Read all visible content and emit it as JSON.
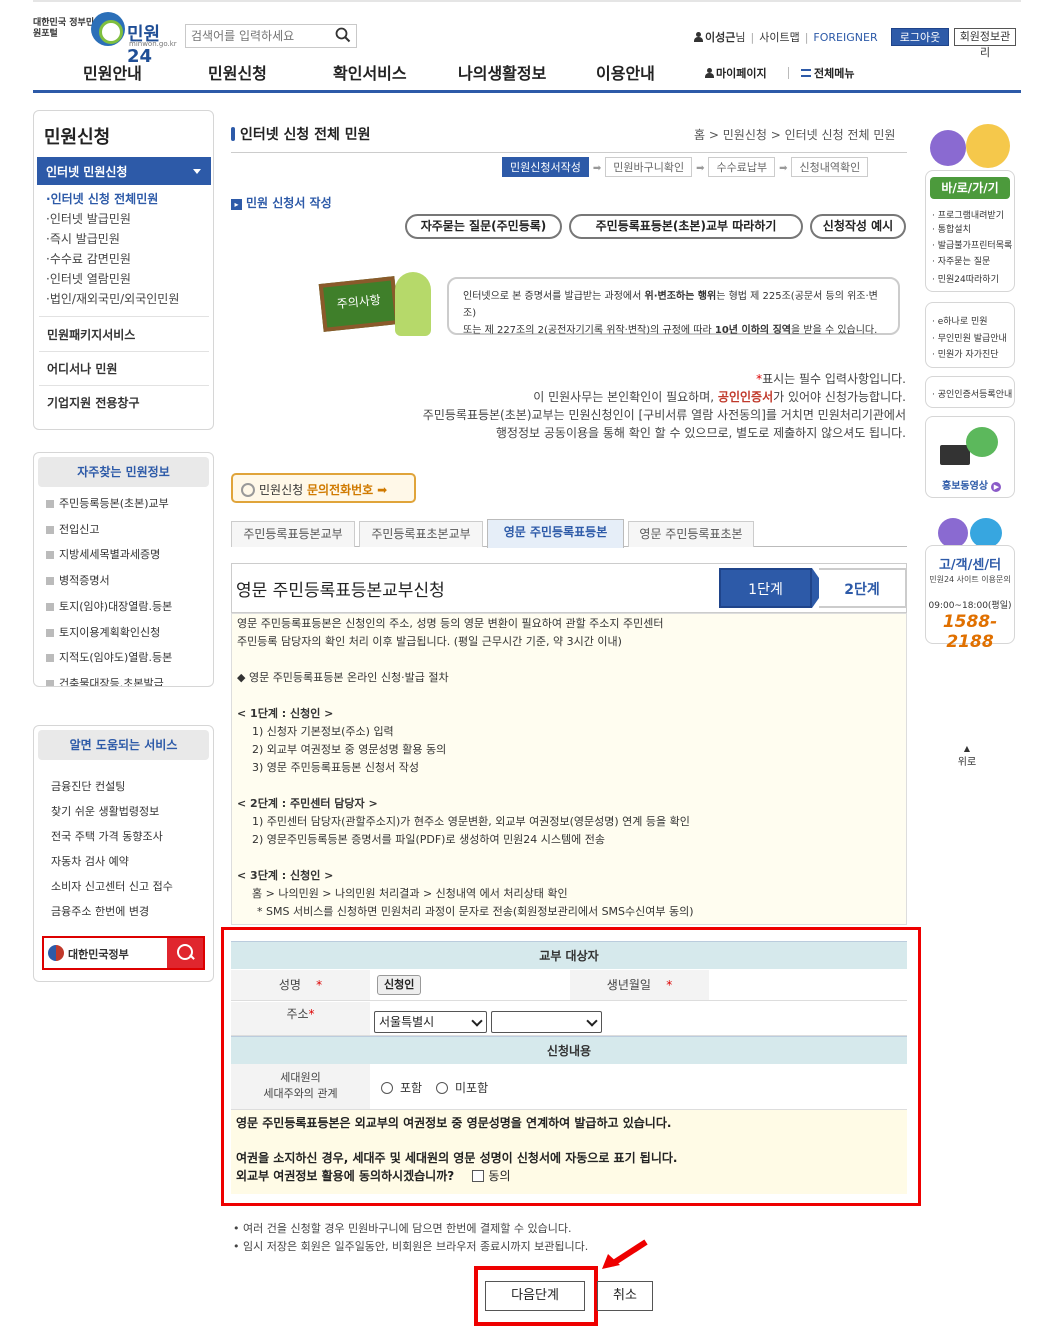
{
  "header": {
    "gov_label": "대한민국 정부민원포털",
    "logo_text": "민원24",
    "logo_url": "minwon.go.kr",
    "search_placeholder": "검색어를 입력하세요",
    "user_name": "이성근",
    "user_suffix": "님",
    "sitemap": "사이트맵",
    "foreigner": "FOREIGNER",
    "logout": "로그아웃",
    "member_info": "회원정보관리"
  },
  "gnb": {
    "items": [
      "민원안내",
      "민원신청",
      "확인서비스",
      "나의생활정보",
      "이용안내"
    ],
    "mypage": "마이페이지",
    "allmenu": "전체메뉴"
  },
  "lnb": {
    "title": "민원신청",
    "active": "인터넷 민원신청",
    "subs": [
      "인터넷 신청 전체민원",
      "인터넷 발급민원",
      "즉시 발급민원",
      "수수료 감면민원",
      "인터넷 열람민원",
      "법인/재외국민/외국인민원"
    ],
    "mains": [
      "민원패키지서비스",
      "어디서나 민원",
      "기업지원 전용창구"
    ]
  },
  "faq": {
    "title": "자주찾는 민원정보",
    "items": [
      "주민등록등본(초본)교부",
      "전입신고",
      "지방세세목별과세증명",
      "병적증명서",
      "토지(임야)대장열람.등본",
      "토지이용계획확인신청",
      "지적도(임야도)열람.등본",
      "건축물대장등.초본발급"
    ]
  },
  "help": {
    "title": "알면 도움되는 서비스",
    "items": [
      "금융진단 컨설팅",
      "찾기 쉬운 생활법령정보",
      "전국 주택 가격 동향조사",
      "자동차 검사 예약",
      "소비자 신고센터 신고 접수",
      "금융주소 한번에 변경"
    ],
    "banner": "대한민국정부"
  },
  "main": {
    "page_title": "인터넷 신청 전체 민원",
    "breadcrumb": [
      "홈",
      "민원신청",
      "인터넷 신청 전체 민원"
    ],
    "steps": [
      "민원신청서작성",
      "민원바구니확인",
      "수수료납부",
      "신청내역확인"
    ],
    "section_title": "민원 신청서 작성",
    "round_buttons": [
      "자주묻는 질문(주민등록)",
      "주민등록표등본(초본)교부 따라하기",
      "신청작성 예시"
    ],
    "notice_board": "주의사항",
    "notice_pre": "인터넷으로 본 증명서를 발급받는 과정에서 ",
    "notice_bold1": "위·변조하는 행위",
    "notice_mid": "는 형법 제 225조(공문서 등의 위조·변조)",
    "notice_line2_pre": "또는 제 227조의 2(공전자기기록 위작·변작)의 규정에 따라 ",
    "notice_bold2": "10년 이하의 징역",
    "notice_line2_post": "을 받을 수 있습니다.",
    "info1_star": "*",
    "info1": "표시는 필수 입력사항입니다.",
    "info2_pre": "이 민원사무는 본인확인이 필요하며, ",
    "info2_bold": "공인인증서",
    "info2_post": "가 있어야 신청가능합니다.",
    "info3": "주민등록표등본(초본)교부는 민원신청인이 [구비서류 열람 사전동의]를 거치면 민원처리기관에서",
    "info4": "행정정보 공동이용을 통해 확인 할 수 있으므로, 별도로 제출하지 않으셔도 됩니다.",
    "inquiry_pre": "민원신청 ",
    "inquiry_hl": "문의전화번호",
    "tabs": [
      "주민등록표등본교부",
      "주민등록표초본교부",
      "영문 주민등록표등본",
      "영문 주민등록표초본"
    ],
    "app_title": "영문 주민등록표등본교부신청",
    "stage1": "1단계",
    "stage2": "2단계"
  },
  "guide": {
    "intro1": "영문 주민등록표등본은 신청인의 주소, 성명 등의 영문 변환이 필요하여 관할 주소지 주민센터",
    "intro2": "주민등록 담당자의 확인 처리 이후 발급됩니다. (평일 근무시간 기준, 약 3시간 이내)",
    "proc": "◆ 영문 주민등록표등본 온라인 신청·발급 절차",
    "s1": "< 1단계 : 신청인 >",
    "s1a": "1) 신청자 기본정보(주소) 입력",
    "s1b": "2) 외교부 여권정보 중 영문성명 활용 동의",
    "s1c": "3) 영문 주민등록표등본 신청서 작성",
    "s2": "< 2단계 : 주민센터 담당자 >",
    "s2a": "1) 주민센터 담당자(관할주소지)가 현주소 영문변환, 외교부 여권정보(영문성명) 연계 등을 확인",
    "s2b": "2) 영문주민등록등본 증명서를 파일(PDF)로 생성하여 민원24 시스템에 전송",
    "s3": "< 3단계 : 신청인 >",
    "s3a": "홈 > 나의민원 > 나의민원 처리결과 > 신청내역 에서 처리상태 확인",
    "s3b": "* SMS 서비스를 신청하면 민원처리 과정이 문자로 전송(회원정보관리에서 SMS수신여부 동의)"
  },
  "form": {
    "sec1": "교부 대상자",
    "name_label": "성명",
    "star": "*",
    "applicant_btn": "신청인",
    "birth_label": "생년월일",
    "addr_label": "주소",
    "addr_sel1": "서울특별시",
    "addr_sel2": "",
    "sec2": "신청내용",
    "rel_label1": "세대원의",
    "rel_label2": "세대주와의 관계",
    "opt_include": "포함",
    "opt_exclude": "미포함",
    "consent1": "영문 주민등록표등본은 외교부의 여권정보 중 영문성명을 연계하여 발급하고 있습니다.",
    "consent2": "여권을 소지하신 경우, 세대주 및 세대원의 영문 성명이 신청서에 자동으로 표기 됩니다.",
    "consent3": "외교부 여권정보 활용에 동의하시겠습니까?",
    "agree": "동의"
  },
  "footer": {
    "note1": "여러 건을 신청할 경우 민원바구니에 담으면 한번에 결제할 수 있습니다.",
    "note2": "임시 저장은 회원은 일주일동안, 비회원은 브라우저 종료시까지 보관됩니다.",
    "next": "다음단계",
    "cancel": "취소"
  },
  "quick": {
    "title": "바/로/가/기",
    "items": [
      "프로그램내려받기",
      "통합설치",
      "발급불가프린터목록",
      "자주묻는 질문",
      "민원24따라하기"
    ],
    "items2": [
      "e하나로 민원",
      "무인민원 발급안내",
      "민원가 자가진단"
    ],
    "cert": "공인인증서등록안내",
    "video": "홍보동영상",
    "center_title": "고/객/센/터",
    "center_sub": "민원24 사이트 이용문의",
    "center_hours": "09:00~18:00(평일)",
    "center_phone": "1588-2188",
    "top": "위로"
  },
  "colors": {
    "brand": "#2d5aa8",
    "highlight_outline": "#e00000",
    "section_bg": "#d6e9ec"
  }
}
